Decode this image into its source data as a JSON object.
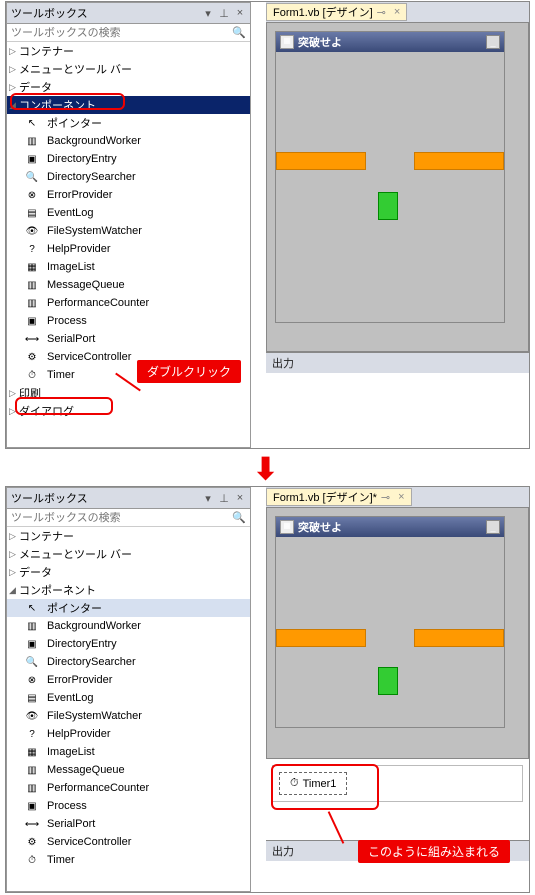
{
  "top": {
    "toolboxTitle": "ツールボックス",
    "searchPlaceholder": "ツールボックスの検索",
    "tabLabel": "Form1.vb [デザイン]",
    "categories": {
      "c0": "コンテナー",
      "c1": "メニューとツール バー",
      "c2": "データ",
      "c3": "コンポーネント",
      "c4": "印刷",
      "c5": "ダイアログ"
    },
    "components": {
      "p0": "ポインター",
      "p1": "BackgroundWorker",
      "p2": "DirectoryEntry",
      "p3": "DirectorySearcher",
      "p4": "ErrorProvider",
      "p5": "EventLog",
      "p6": "FileSystemWatcher",
      "p7": "HelpProvider",
      "p8": "ImageList",
      "p9": "MessageQueue",
      "p10": "PerformanceCounter",
      "p11": "Process",
      "p12": "SerialPort",
      "p13": "ServiceController",
      "p14": "Timer"
    },
    "formTitle": "突破せよ",
    "outputLabel": "出力",
    "calloutDouble": "ダブルクリック"
  },
  "bottom": {
    "toolboxTitle": "ツールボックス",
    "searchPlaceholder": "ツールボックスの検索",
    "tabLabel": "Form1.vb [デザイン]*",
    "categories": {
      "c0": "コンテナー",
      "c1": "メニューとツール バー",
      "c2": "データ",
      "c3": "コンポーネント"
    },
    "components": {
      "p0": "ポインター",
      "p1": "BackgroundWorker",
      "p2": "DirectoryEntry",
      "p3": "DirectorySearcher",
      "p4": "ErrorProvider",
      "p5": "EventLog",
      "p6": "FileSystemWatcher",
      "p7": "HelpProvider",
      "p8": "ImageList",
      "p9": "MessageQueue",
      "p10": "PerformanceCounter",
      "p11": "Process",
      "p12": "SerialPort",
      "p13": "ServiceController",
      "p14": "Timer"
    },
    "formTitle": "突破せよ",
    "timerLabel": "Timer1",
    "outputLabel": "出力",
    "calloutEmbed": "このように組み込まれる"
  }
}
